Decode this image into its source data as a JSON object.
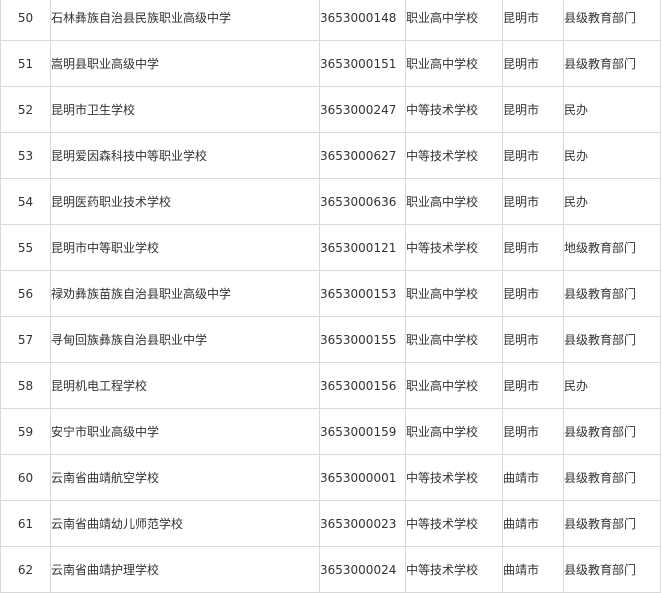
{
  "table": {
    "rows": [
      {
        "num": "50",
        "name": "石林彝族自治县民族职业高级中学",
        "code": "3653000148",
        "type": "职业高中学校",
        "city": "昆明市",
        "owner": "县级教育部门"
      },
      {
        "num": "51",
        "name": "嵩明县职业高级中学",
        "code": "3653000151",
        "type": "职业高中学校",
        "city": "昆明市",
        "owner": "县级教育部门"
      },
      {
        "num": "52",
        "name": "昆明市卫生学校",
        "code": "3653000247",
        "type": "中等技术学校",
        "city": "昆明市",
        "owner": "民办"
      },
      {
        "num": "53",
        "name": "昆明爱因森科技中等职业学校",
        "code": "3653000627",
        "type": "中等技术学校",
        "city": "昆明市",
        "owner": "民办"
      },
      {
        "num": "54",
        "name": "昆明医药职业技术学校",
        "code": "3653000636",
        "type": "职业高中学校",
        "city": "昆明市",
        "owner": "民办"
      },
      {
        "num": "55",
        "name": "昆明市中等职业学校",
        "code": "3653000121",
        "type": "中等技术学校",
        "city": "昆明市",
        "owner": "地级教育部门"
      },
      {
        "num": "56",
        "name": "禄劝彝族苗族自治县职业高级中学",
        "code": "3653000153",
        "type": "职业高中学校",
        "city": "昆明市",
        "owner": "县级教育部门"
      },
      {
        "num": "57",
        "name": "寻甸回族彝族自治县职业中学",
        "code": "3653000155",
        "type": "职业高中学校",
        "city": "昆明市",
        "owner": "县级教育部门"
      },
      {
        "num": "58",
        "name": "昆明机电工程学校",
        "code": "3653000156",
        "type": "职业高中学校",
        "city": "昆明市",
        "owner": "民办"
      },
      {
        "num": "59",
        "name": "安宁市职业高级中学",
        "code": "3653000159",
        "type": "职业高中学校",
        "city": "昆明市",
        "owner": "县级教育部门"
      },
      {
        "num": "60",
        "name": "云南省曲靖航空学校",
        "code": "3653000001",
        "type": "中等技术学校",
        "city": "曲靖市",
        "owner": "县级教育部门"
      },
      {
        "num": "61",
        "name": "云南省曲靖幼儿师范学校",
        "code": "3653000023",
        "type": "中等技术学校",
        "city": "曲靖市",
        "owner": "县级教育部门"
      },
      {
        "num": "62",
        "name": "云南省曲靖护理学校",
        "code": "3653000024",
        "type": "中等技术学校",
        "city": "曲靖市",
        "owner": "县级教育部门"
      }
    ]
  },
  "colors": {
    "border": "#d9d9d9",
    "text": "#333333",
    "background": "#ffffff"
  }
}
